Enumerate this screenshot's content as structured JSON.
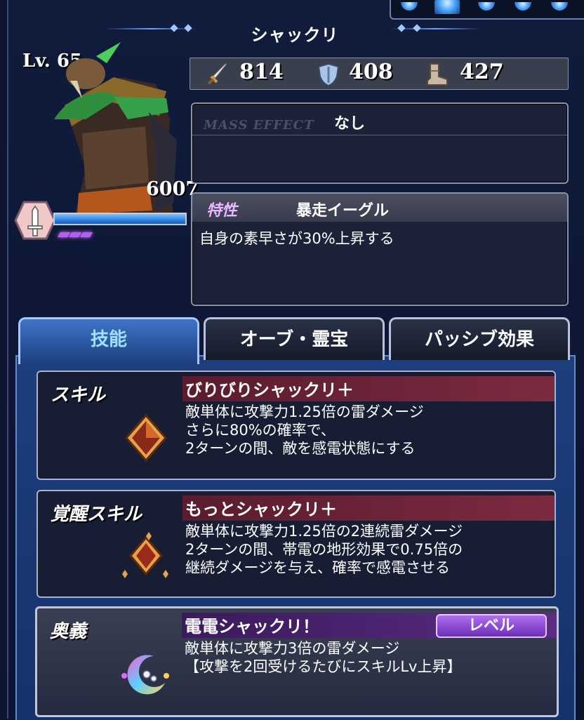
{
  "unit": {
    "name": "シャックリ",
    "level": "Lv. 65",
    "hp": "6007"
  },
  "stats": {
    "attack": "814",
    "defense": "408",
    "speed": "427"
  },
  "mass_effect": {
    "label": "MASS EFFECT",
    "value": "なし"
  },
  "trait": {
    "label": "特性",
    "name": "暴走イーグル",
    "description": "自身の素早さが30%上昇する"
  },
  "hp_bar_fraction": 1.0,
  "tabs": [
    "技能",
    "オーブ・霊宝",
    "パッシブ効果"
  ],
  "skills": [
    {
      "label": "スキル",
      "name": "びりびりシャックリ＋",
      "description": "敵単体に攻撃力1.25倍の雷ダメージ\nさらに80%の確率で、\n2ターンの間、敵を感電状態にする"
    },
    {
      "label": "覚醒スキル",
      "name": "もっとシャックリ＋",
      "description": "敵単体に攻撃力1.25倍の2連続雷ダメージ\n2ターンの間、帯電の地形効果で0.75倍の\n継続ダメージを与え、確率で感電させる"
    },
    {
      "label": "奥義",
      "name": "電電シャックリ！",
      "button": "レベル",
      "description": "敵単体に攻撃力3倍の雷ダメージ\n【攻撃を2回受けるたびにスキルLv上昇】"
    }
  ],
  "colors": {
    "accent": "#9fe2ff",
    "trait": "#e9b7ff",
    "skill_bar": "#7d2a40",
    "ult_bar": "#5a2c82",
    "charge": "#b65cff"
  }
}
